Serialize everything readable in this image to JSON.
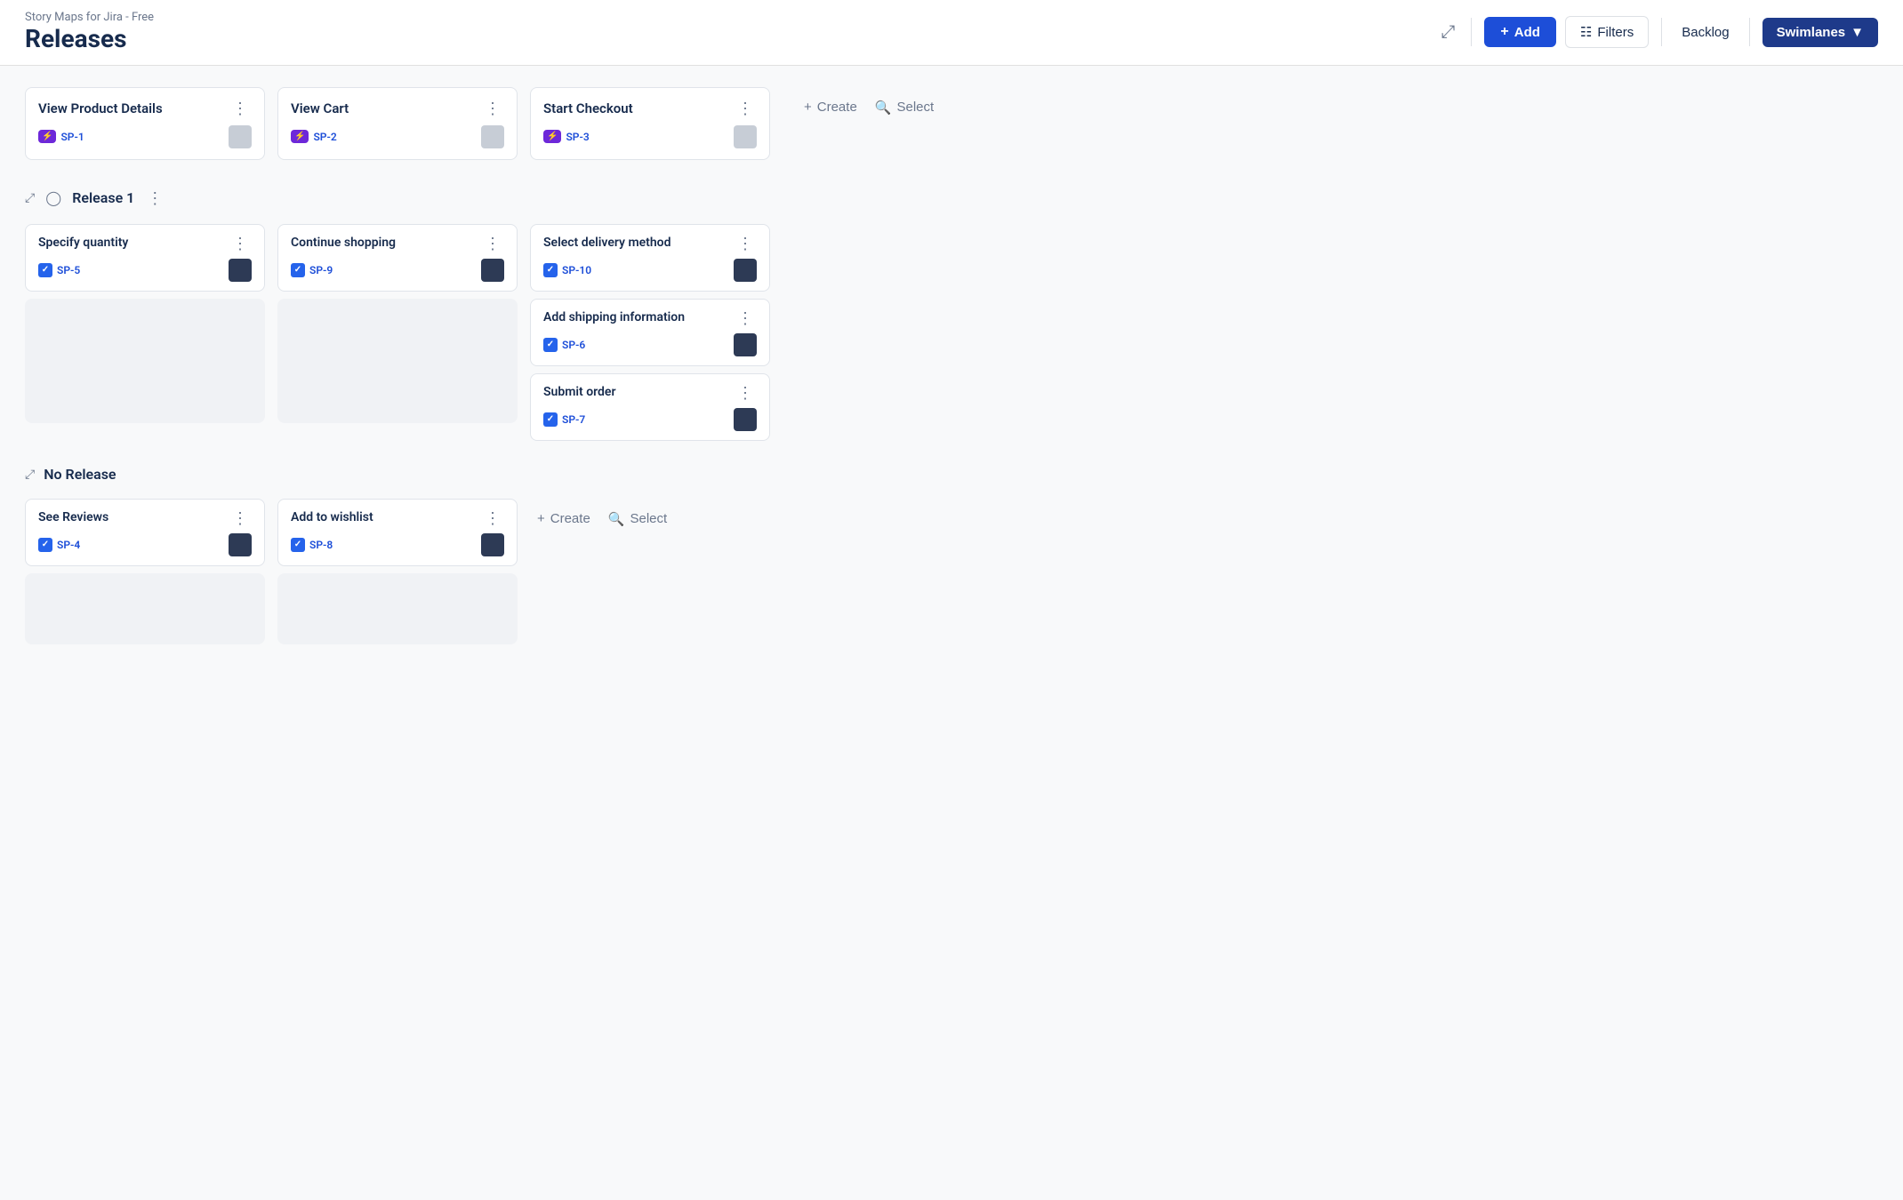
{
  "app": {
    "name": "Story Maps for Jira - Free"
  },
  "header": {
    "title": "Releases",
    "add_label": "+ Add",
    "filters_label": "Filters",
    "backlog_label": "Backlog",
    "swimlanes_label": "Swimlanes"
  },
  "epics": [
    {
      "title": "View Product Details",
      "ticket": "SP-1",
      "ticket_type": "lightning"
    },
    {
      "title": "View Cart",
      "ticket": "SP-2",
      "ticket_type": "lightning"
    },
    {
      "title": "Start Checkout",
      "ticket": "SP-3",
      "ticket_type": "lightning"
    }
  ],
  "swimlanes": [
    {
      "id": "release1",
      "label": "Release 1",
      "icon": "box",
      "columns": [
        {
          "epic_index": 0,
          "stories": [
            {
              "title": "Specify quantity",
              "ticket": "SP-5",
              "ticket_type": "check"
            }
          ]
        },
        {
          "epic_index": 1,
          "stories": [
            {
              "title": "Continue shopping",
              "ticket": "SP-9",
              "ticket_type": "check"
            }
          ]
        },
        {
          "epic_index": 2,
          "stories": [
            {
              "title": "Select delivery method",
              "ticket": "SP-10",
              "ticket_type": "check"
            },
            {
              "title": "Add shipping information",
              "ticket": "SP-6",
              "ticket_type": "check"
            },
            {
              "title": "Submit order",
              "ticket": "SP-7",
              "ticket_type": "check"
            }
          ]
        }
      ]
    },
    {
      "id": "no-release",
      "label": "No Release",
      "icon": "none",
      "columns": [
        {
          "epic_index": 0,
          "stories": [
            {
              "title": "See Reviews",
              "ticket": "SP-4",
              "ticket_type": "check"
            }
          ]
        },
        {
          "epic_index": 1,
          "stories": [
            {
              "title": "Add to wishlist",
              "ticket": "SP-8",
              "ticket_type": "check"
            }
          ]
        },
        {
          "epic_index": 2,
          "stories": []
        }
      ]
    }
  ],
  "actions": {
    "create_label": "+ Create",
    "select_label": "Select"
  }
}
